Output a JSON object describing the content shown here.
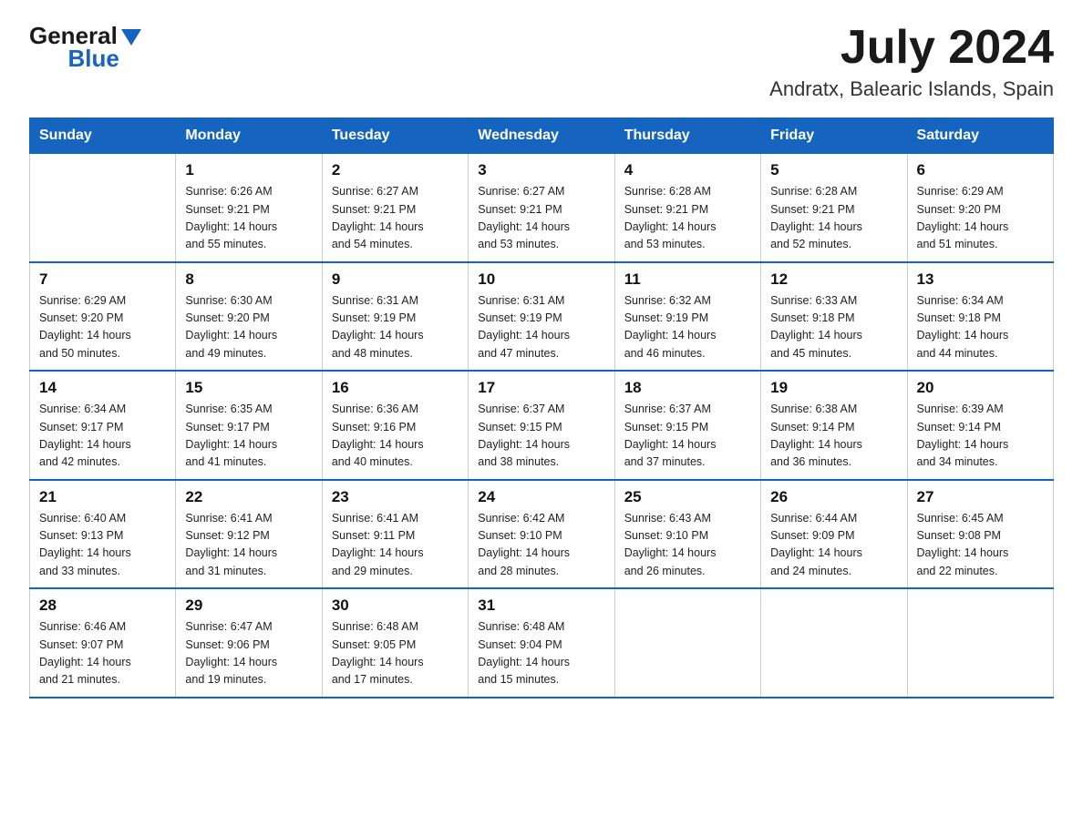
{
  "logo": {
    "text_general": "General",
    "text_blue": "Blue"
  },
  "header": {
    "month_year": "July 2024",
    "location": "Andratx, Balearic Islands, Spain"
  },
  "days_of_week": [
    "Sunday",
    "Monday",
    "Tuesday",
    "Wednesday",
    "Thursday",
    "Friday",
    "Saturday"
  ],
  "weeks": [
    [
      {
        "day": "",
        "info": ""
      },
      {
        "day": "1",
        "info": "Sunrise: 6:26 AM\nSunset: 9:21 PM\nDaylight: 14 hours\nand 55 minutes."
      },
      {
        "day": "2",
        "info": "Sunrise: 6:27 AM\nSunset: 9:21 PM\nDaylight: 14 hours\nand 54 minutes."
      },
      {
        "day": "3",
        "info": "Sunrise: 6:27 AM\nSunset: 9:21 PM\nDaylight: 14 hours\nand 53 minutes."
      },
      {
        "day": "4",
        "info": "Sunrise: 6:28 AM\nSunset: 9:21 PM\nDaylight: 14 hours\nand 53 minutes."
      },
      {
        "day": "5",
        "info": "Sunrise: 6:28 AM\nSunset: 9:21 PM\nDaylight: 14 hours\nand 52 minutes."
      },
      {
        "day": "6",
        "info": "Sunrise: 6:29 AM\nSunset: 9:20 PM\nDaylight: 14 hours\nand 51 minutes."
      }
    ],
    [
      {
        "day": "7",
        "info": "Sunrise: 6:29 AM\nSunset: 9:20 PM\nDaylight: 14 hours\nand 50 minutes."
      },
      {
        "day": "8",
        "info": "Sunrise: 6:30 AM\nSunset: 9:20 PM\nDaylight: 14 hours\nand 49 minutes."
      },
      {
        "day": "9",
        "info": "Sunrise: 6:31 AM\nSunset: 9:19 PM\nDaylight: 14 hours\nand 48 minutes."
      },
      {
        "day": "10",
        "info": "Sunrise: 6:31 AM\nSunset: 9:19 PM\nDaylight: 14 hours\nand 47 minutes."
      },
      {
        "day": "11",
        "info": "Sunrise: 6:32 AM\nSunset: 9:19 PM\nDaylight: 14 hours\nand 46 minutes."
      },
      {
        "day": "12",
        "info": "Sunrise: 6:33 AM\nSunset: 9:18 PM\nDaylight: 14 hours\nand 45 minutes."
      },
      {
        "day": "13",
        "info": "Sunrise: 6:34 AM\nSunset: 9:18 PM\nDaylight: 14 hours\nand 44 minutes."
      }
    ],
    [
      {
        "day": "14",
        "info": "Sunrise: 6:34 AM\nSunset: 9:17 PM\nDaylight: 14 hours\nand 42 minutes."
      },
      {
        "day": "15",
        "info": "Sunrise: 6:35 AM\nSunset: 9:17 PM\nDaylight: 14 hours\nand 41 minutes."
      },
      {
        "day": "16",
        "info": "Sunrise: 6:36 AM\nSunset: 9:16 PM\nDaylight: 14 hours\nand 40 minutes."
      },
      {
        "day": "17",
        "info": "Sunrise: 6:37 AM\nSunset: 9:15 PM\nDaylight: 14 hours\nand 38 minutes."
      },
      {
        "day": "18",
        "info": "Sunrise: 6:37 AM\nSunset: 9:15 PM\nDaylight: 14 hours\nand 37 minutes."
      },
      {
        "day": "19",
        "info": "Sunrise: 6:38 AM\nSunset: 9:14 PM\nDaylight: 14 hours\nand 36 minutes."
      },
      {
        "day": "20",
        "info": "Sunrise: 6:39 AM\nSunset: 9:14 PM\nDaylight: 14 hours\nand 34 minutes."
      }
    ],
    [
      {
        "day": "21",
        "info": "Sunrise: 6:40 AM\nSunset: 9:13 PM\nDaylight: 14 hours\nand 33 minutes."
      },
      {
        "day": "22",
        "info": "Sunrise: 6:41 AM\nSunset: 9:12 PM\nDaylight: 14 hours\nand 31 minutes."
      },
      {
        "day": "23",
        "info": "Sunrise: 6:41 AM\nSunset: 9:11 PM\nDaylight: 14 hours\nand 29 minutes."
      },
      {
        "day": "24",
        "info": "Sunrise: 6:42 AM\nSunset: 9:10 PM\nDaylight: 14 hours\nand 28 minutes."
      },
      {
        "day": "25",
        "info": "Sunrise: 6:43 AM\nSunset: 9:10 PM\nDaylight: 14 hours\nand 26 minutes."
      },
      {
        "day": "26",
        "info": "Sunrise: 6:44 AM\nSunset: 9:09 PM\nDaylight: 14 hours\nand 24 minutes."
      },
      {
        "day": "27",
        "info": "Sunrise: 6:45 AM\nSunset: 9:08 PM\nDaylight: 14 hours\nand 22 minutes."
      }
    ],
    [
      {
        "day": "28",
        "info": "Sunrise: 6:46 AM\nSunset: 9:07 PM\nDaylight: 14 hours\nand 21 minutes."
      },
      {
        "day": "29",
        "info": "Sunrise: 6:47 AM\nSunset: 9:06 PM\nDaylight: 14 hours\nand 19 minutes."
      },
      {
        "day": "30",
        "info": "Sunrise: 6:48 AM\nSunset: 9:05 PM\nDaylight: 14 hours\nand 17 minutes."
      },
      {
        "day": "31",
        "info": "Sunrise: 6:48 AM\nSunset: 9:04 PM\nDaylight: 14 hours\nand 15 minutes."
      },
      {
        "day": "",
        "info": ""
      },
      {
        "day": "",
        "info": ""
      },
      {
        "day": "",
        "info": ""
      }
    ]
  ]
}
